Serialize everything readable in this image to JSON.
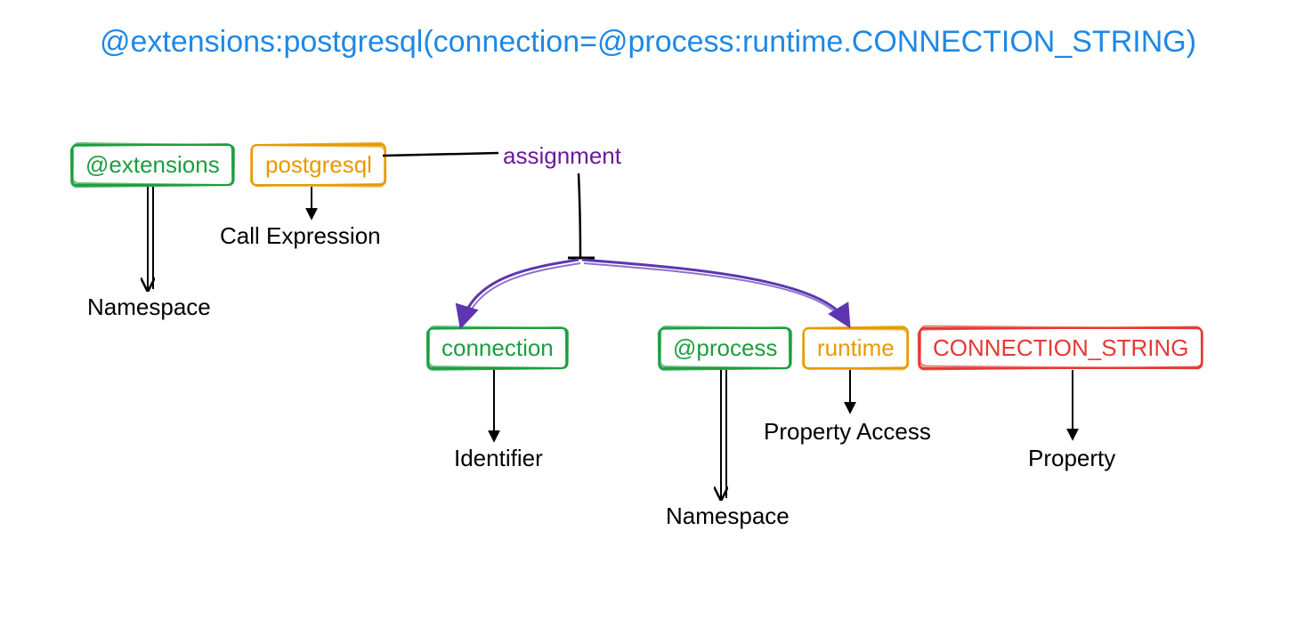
{
  "title": "@extensions:postgresql(connection=@process:runtime.CONNECTION_STRING)",
  "nodes": {
    "extensions": "@extensions",
    "postgresql": "postgresql",
    "connection": "connection",
    "process": "@process",
    "runtime": "runtime",
    "connstr": "CONNECTION_STRING"
  },
  "assignment_label": "assignment",
  "labels": {
    "namespace1": "Namespace",
    "call_expression": "Call Expression",
    "identifier": "Identifier",
    "namespace2": "Namespace",
    "property_access": "Property Access",
    "property": "Property"
  },
  "colors": {
    "title": "#1E88E5",
    "green": "#1B9E3F",
    "orange": "#E69A00",
    "red": "#E53935",
    "purple": "#6A1B9A",
    "arrow_purple": "#5E35B1",
    "black": "#000000"
  }
}
